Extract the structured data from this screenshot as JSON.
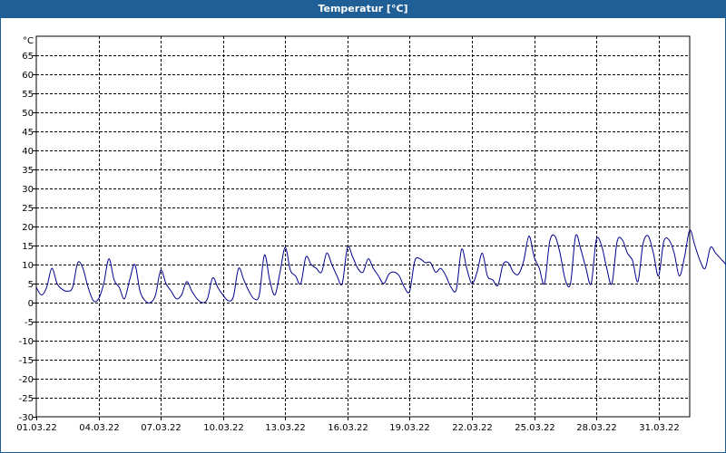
{
  "window": {
    "title": "Temperatur [°C]"
  },
  "colors": {
    "title_bar": "#1f5f96",
    "series_line": "#00008b",
    "grid": "#000000",
    "background": "#ffffff"
  },
  "chart_data": {
    "type": "line",
    "title": "Temperatur [°C]",
    "ylabel": "°C",
    "xlabel": "",
    "ylim": [
      -30,
      70
    ],
    "yticks": [
      65,
      60,
      55,
      50,
      45,
      40,
      35,
      30,
      25,
      20,
      15,
      10,
      5,
      0,
      -5,
      -10,
      -15,
      -20,
      -25,
      -30
    ],
    "xticks": [
      "01.03.22",
      "04.03.22",
      "07.03.22",
      "10.03.22",
      "13.03.22",
      "16.03.22",
      "19.03.22",
      "22.03.22",
      "25.03.22",
      "28.03.22",
      "31.03.22"
    ],
    "xlim": [
      "2022-03-01",
      "2022-04-01 12:00"
    ],
    "grid": true,
    "legend": "none",
    "series": [
      {
        "sample_interval_hours": 6,
        "start": "2022-03-01 00:00",
        "values": [
          4.0,
          2.0,
          4.0,
          9.0,
          5.0,
          3.5,
          3.0,
          4.0,
          10.5,
          9.0,
          4.0,
          0.5,
          1.0,
          5.0,
          11.5,
          6.0,
          4.0,
          1.0,
          6.0,
          10.0,
          3.0,
          0.5,
          0.0,
          2.0,
          8.5,
          5.0,
          3.0,
          1.0,
          2.0,
          5.5,
          3.0,
          1.0,
          0.0,
          1.0,
          6.5,
          4.0,
          2.0,
          0.5,
          1.5,
          9.0,
          6.0,
          3.0,
          1.0,
          2.0,
          12.5,
          6.0,
          2.0,
          8.0,
          14.5,
          8.5,
          7.0,
          5.0,
          12.0,
          10.0,
          9.0,
          8.0,
          13.0,
          10.0,
          7.0,
          5.0,
          14.5,
          12.0,
          9.0,
          8.0,
          11.5,
          9.0,
          7.0,
          5.0,
          7.5,
          8.0,
          7.0,
          4.0,
          3.0,
          11.0,
          11.5,
          10.5,
          10.5,
          8.0,
          9.0,
          7.0,
          4.0,
          3.5,
          14.0,
          9.0,
          5.0,
          8.0,
          13.0,
          7.0,
          6.0,
          4.5,
          10.0,
          10.5,
          8.0,
          7.5,
          11.0,
          17.5,
          12.0,
          9.0,
          5.0,
          16.0,
          17.5,
          13.0,
          6.0,
          5.0,
          17.5,
          14.0,
          9.0,
          5.0,
          16.5,
          15.0,
          9.0,
          5.0,
          16.0,
          16.5,
          13.0,
          11.0,
          5.5,
          15.5,
          17.5,
          13.0,
          7.0,
          16.0,
          16.5,
          13.0,
          7.0,
          12.0,
          19.0,
          15.0,
          11.0,
          9.0,
          14.5,
          13.0,
          11.5,
          10.0,
          8.0,
          9.5,
          12.5,
          10.0,
          7.0,
          5.5,
          5.0,
          6.0,
          4.0,
          2.5
        ]
      }
    ]
  }
}
